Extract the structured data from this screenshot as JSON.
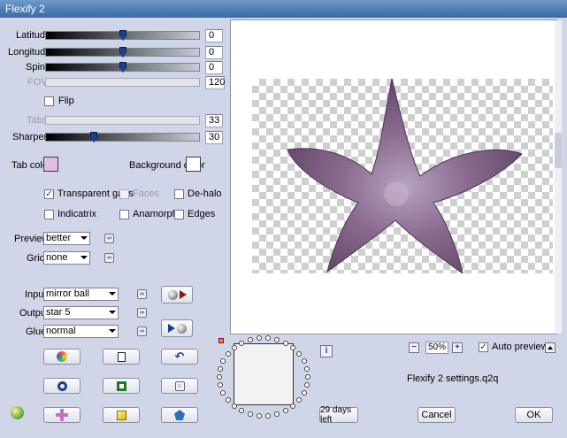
{
  "window": {
    "title": "Flexify 2"
  },
  "sliders": [
    {
      "label": "Latitude",
      "value": "0",
      "position": 0.5,
      "disabled": false
    },
    {
      "label": "Longitude",
      "value": "0",
      "position": 0.5,
      "disabled": false
    },
    {
      "label": "Spin",
      "value": "0",
      "position": 0.5,
      "disabled": false
    },
    {
      "label": "FOV",
      "value": "120",
      "position": null,
      "disabled": true
    },
    {
      "label": "Tabs",
      "value": "33",
      "position": null,
      "disabled": true
    },
    {
      "label": "Sharpen",
      "value": "30",
      "position": 0.3,
      "disabled": false
    }
  ],
  "flip": {
    "label": "Flip",
    "checked": false
  },
  "colors": {
    "tab_color_label": "Tab color",
    "tab_color": "#e2bde3",
    "background_color_label": "Background color",
    "background_color": "#ffffff"
  },
  "options": {
    "transparent_gaps": {
      "label": "Transparent gaps",
      "checked": true
    },
    "faces": {
      "label": "Faces",
      "checked": false
    },
    "de_halo": {
      "label": "De-halo",
      "checked": false
    },
    "indicatrix": {
      "label": "Indicatrix",
      "checked": false
    },
    "anamorph": {
      "label": "Anamorph",
      "checked": false
    },
    "edges": {
      "label": "Edges",
      "checked": false
    }
  },
  "preview": {
    "label": "Preview",
    "value": "better"
  },
  "grid": {
    "label": "Grid",
    "value": "none"
  },
  "mapping": {
    "input": {
      "label": "Input",
      "value": "mirror ball"
    },
    "output": {
      "label": "Output",
      "value": "star 5"
    },
    "glue": {
      "label": "Glue",
      "value": "normal"
    }
  },
  "zoom": {
    "minus": "−",
    "value": "50%",
    "plus": "+"
  },
  "auto_preview": {
    "label": "Auto preview",
    "checked": true
  },
  "settings_file": "Flexify 2 settings.q2q",
  "trial_button": "29 days left",
  "cancel_button": "Cancel",
  "ok_button": "OK",
  "info_icon": "i"
}
